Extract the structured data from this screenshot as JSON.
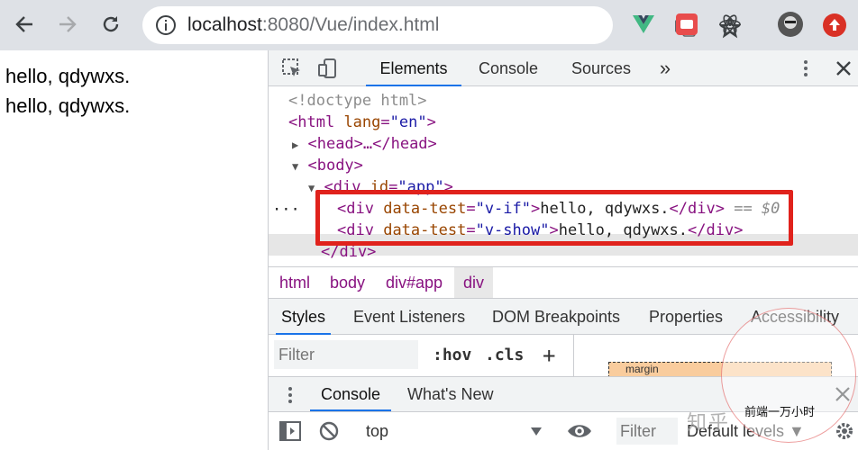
{
  "browser": {
    "url_host": "localhost",
    "url_rest": ":8080/Vue/index.html"
  },
  "page": {
    "lines": [
      "hello, qdywxs.",
      "hello, qdywxs."
    ]
  },
  "devtools": {
    "tabs": [
      "Elements",
      "Console",
      "Sources"
    ],
    "more": "»",
    "tree": {
      "doctype": "<!doctype html>",
      "html_open_tag": "<html",
      "html_lang_attr": "lang",
      "html_lang_val": "\"en\"",
      "html_close": ">",
      "head_line": "<head>…</head>",
      "body_open": "<body>",
      "div_app_tag": "<div",
      "div_app_attr": "id",
      "div_app_val": "\"app\"",
      "div_app_close": ">",
      "row_dots": "···",
      "row1": {
        "open": "<div",
        "attr": "data-test",
        "val": "\"v-if\"",
        "gt": ">",
        "text": "hello, qdywxs.",
        "close": "</div>",
        "suffix": "== $0"
      },
      "row2": {
        "open": "<div",
        "attr": "data-test",
        "val": "\"v-show\"",
        "gt": ">",
        "text": "hello, qdywxs.",
        "close": "</div>"
      },
      "div_close": "</div>"
    },
    "breadcrumbs": [
      "html",
      "body",
      "div#app",
      "div"
    ],
    "subtabs": [
      "Styles",
      "Event Listeners",
      "DOM Breakpoints",
      "Properties",
      "Accessibility"
    ],
    "styles_filter_placeholder": "Filter",
    "hov": ":hov",
    "cls": ".cls",
    "plus": "+",
    "boxmodel_label": "margin",
    "drawer_tabs": [
      "Console",
      "What's New"
    ],
    "console_context": "top",
    "console_filter_placeholder": "Filter",
    "console_levels": "Default levels ▼"
  },
  "watermark": {
    "zh": "知乎",
    "text": "前端一万小时"
  },
  "colors": {
    "accent": "#1a73e8",
    "highlight_box": "#e0221c"
  }
}
